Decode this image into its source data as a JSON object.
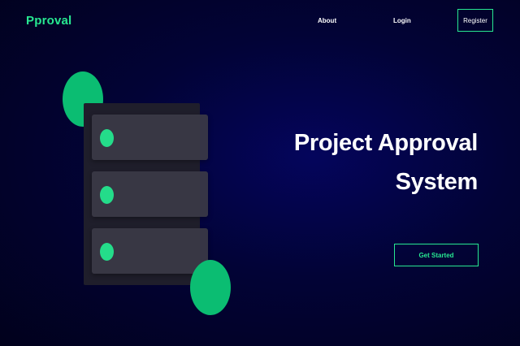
{
  "brand": {
    "name": "Pproval"
  },
  "nav": {
    "about": "About",
    "login": "Login",
    "register": "Register"
  },
  "hero": {
    "title_line1": "Project Approval",
    "title_line2": "System",
    "cta": "Get Started"
  },
  "colors": {
    "accent": "#27e891",
    "background": "#020336",
    "card": "#3a3946"
  },
  "illustration": {
    "icon": "server-rack-icon",
    "units": 3
  }
}
